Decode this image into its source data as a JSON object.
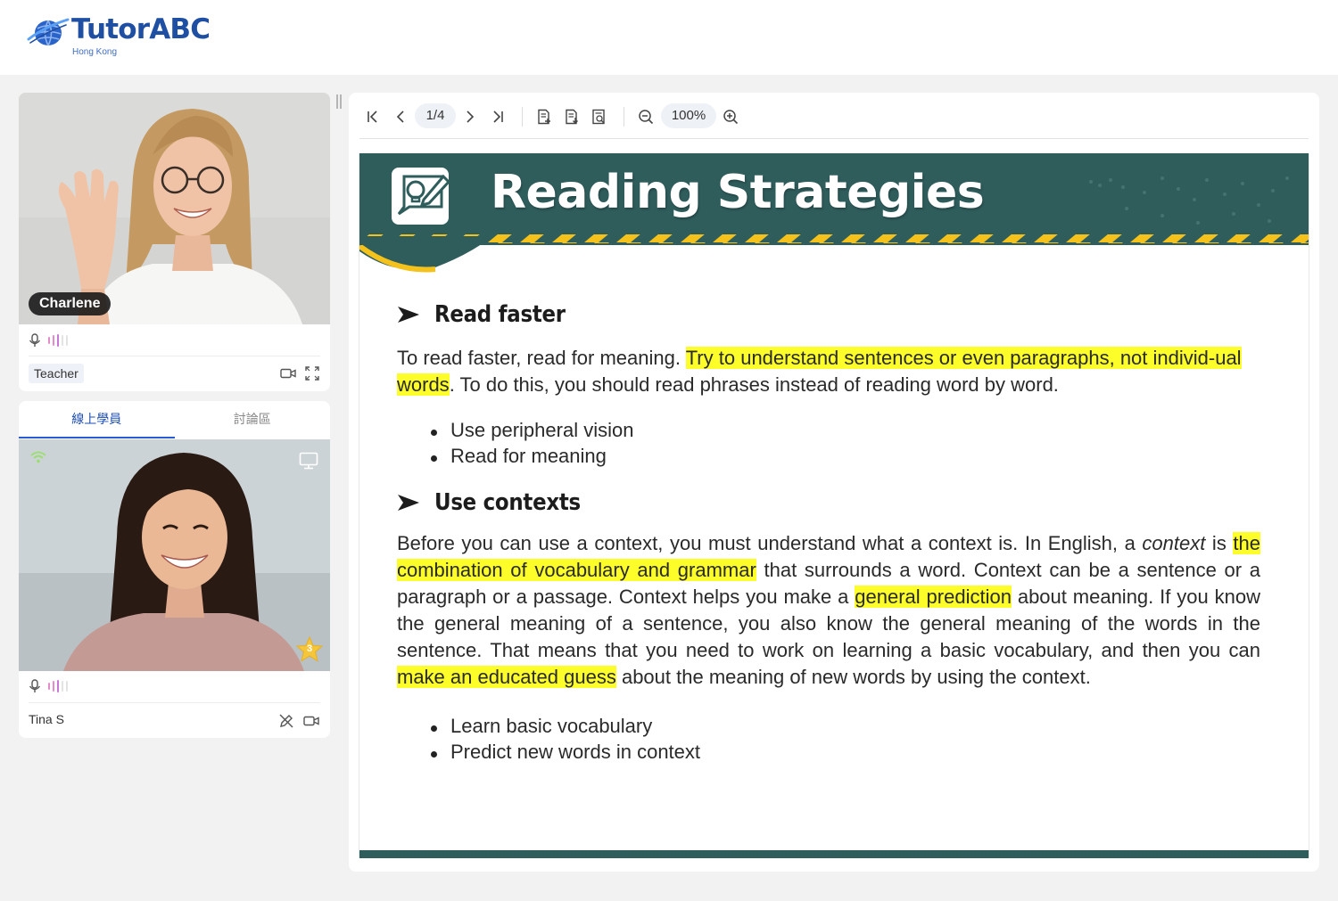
{
  "brand": {
    "name": "TutorABC",
    "region": "Hong Kong",
    "color": "#1f4fa3"
  },
  "teacher": {
    "name": "Charlene",
    "role": "Teacher"
  },
  "tabs": [
    {
      "label": "線上學員",
      "active": true
    },
    {
      "label": "討論區",
      "active": false
    }
  ],
  "student": {
    "name": "Tina S",
    "stars": "3"
  },
  "toolbar": {
    "page": "1/4",
    "zoom": "100%"
  },
  "slide": {
    "title": "Reading Strategies",
    "sections": [
      {
        "heading": "Read faster",
        "para": [
          "To read faster, read for meaning. ",
          "Try to understand sentences or even paragraphs, not individ-ual words",
          ". To do this, you should read phrases instead of reading word by word."
        ],
        "bullets": [
          "Use peripheral vision",
          "Read for meaning"
        ]
      },
      {
        "heading": "Use contexts",
        "para": [
          "Before you can use a context, you must understand what a context is. In English, a ",
          "context",
          " is ",
          "the combination of vocabulary and grammar",
          " that surrounds a word. Context can be a sentence or a paragraph or a passage. Context helps you make a ",
          "general prediction",
          " about meaning. If you know the general meaning of a sentence, you also know the general meaning of the words in the sentence. That means that you need to work on learning a basic vocabulary, and then you can ",
          "make an educated guess",
          " about the meaning of new words by using the context."
        ],
        "bullets": [
          "Learn basic vocabulary",
          "Predict new words in context"
        ]
      }
    ]
  },
  "colors": {
    "accent": "#2a5bd7",
    "highlight": "#fdfd29",
    "banner": "#2f5d5c",
    "stripe": "#f4c21b"
  }
}
